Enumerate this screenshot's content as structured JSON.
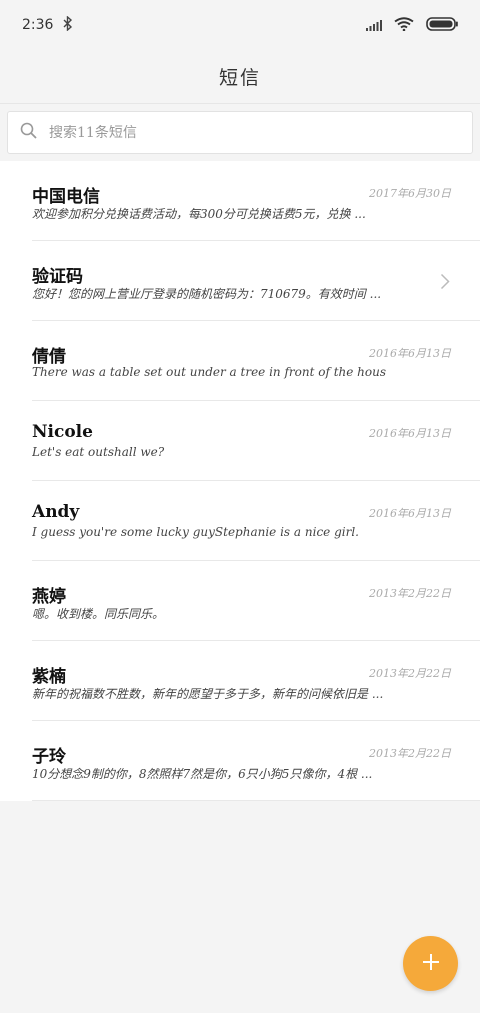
{
  "status": {
    "time": "2:36",
    "icons": [
      "bluetooth-icon",
      "signal-icon",
      "wifi-icon",
      "battery-icon"
    ]
  },
  "header": {
    "title": "短信"
  },
  "search": {
    "placeholder": "搜索11条短信"
  },
  "messages": [
    {
      "name": "中国电信",
      "date": "2017年6月30日",
      "preview": "欢迎参加积分兑换话费活动，每300分可兑换话费5元，兑换 ...",
      "has_chevron": false
    },
    {
      "name": "验证码",
      "date": "",
      "preview": "您好！您的网上营业厅登录的随机密码为：710679。有效时间 ...",
      "has_chevron": true
    },
    {
      "name": "倩倩",
      "date": "2016年6月13日",
      "preview": "There was a table set out under a tree in front of the hous",
      "has_chevron": false
    },
    {
      "name": "Nicole",
      "date": "2016年6月13日",
      "preview": "Let's eat outshall we?",
      "has_chevron": false
    },
    {
      "name": "Andy",
      "date": "2016年6月13日",
      "preview": "I guess you're some lucky guyStephanie is a nice girl.",
      "has_chevron": false
    },
    {
      "name": "燕婷",
      "date": "2013年2月22日",
      "preview": "嗯。收到楼。同乐同乐。",
      "has_chevron": false
    },
    {
      "name": "紫楠",
      "date": "2013年2月22日",
      "preview": "新年的祝福数不胜数，新年的愿望于多于多，新年的问候依旧是 ...",
      "has_chevron": false
    },
    {
      "name": "子玲",
      "date": "2013年2月22日",
      "preview": "10分想念9制的你，8然照样7然是你，6只小狗5只像你，4根 ...",
      "has_chevron": false
    }
  ],
  "fab": {
    "icon": "plus-icon",
    "color": "#f5a93a"
  }
}
